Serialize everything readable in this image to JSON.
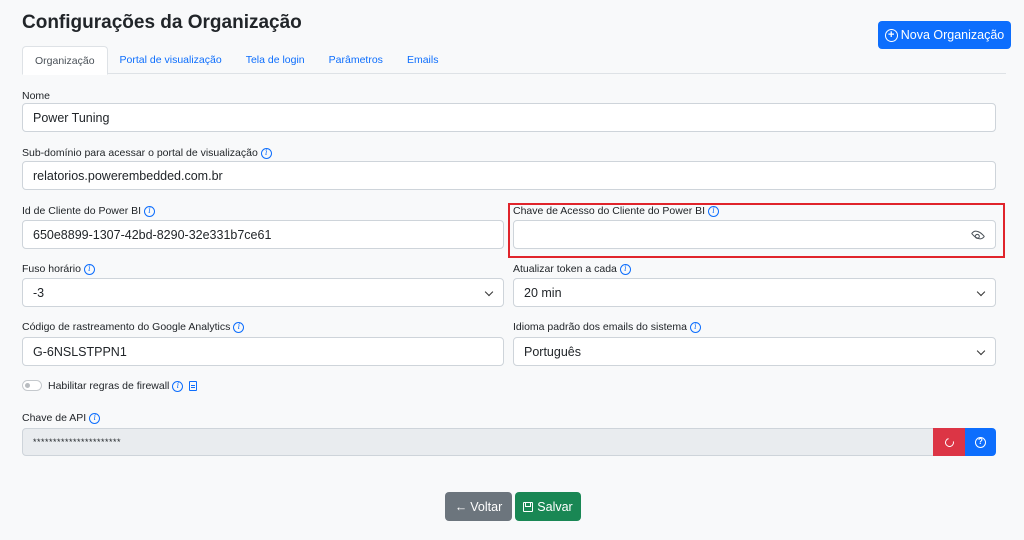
{
  "header": {
    "title": "Configurações da Organização",
    "new_org_label": "Nova Organização"
  },
  "tabs": [
    {
      "label": "Organização",
      "active": true
    },
    {
      "label": "Portal de visualização",
      "active": false
    },
    {
      "label": "Tela de login",
      "active": false
    },
    {
      "label": "Parâmetros",
      "active": false
    },
    {
      "label": "Emails",
      "active": false
    }
  ],
  "form": {
    "name": {
      "label": "Nome",
      "value": "Power Tuning"
    },
    "subdomain": {
      "label": "Sub-domínio para acessar o portal de visualização",
      "value": "relatorios.powerembedded.com.br"
    },
    "client_id": {
      "label": "Id de Cliente do Power BI",
      "value": "650e8899-1307-42bd-8290-32e331b7ce61"
    },
    "client_key": {
      "label": "Chave de Acesso do Cliente do Power BI",
      "value": ""
    },
    "timezone": {
      "label": "Fuso horário",
      "value": "-3"
    },
    "token_refresh": {
      "label": "Atualizar token a cada",
      "value": "20 min"
    },
    "analytics": {
      "label": "Código de rastreamento do Google Analytics",
      "value": "G-6NSLSTPPN1"
    },
    "email_language": {
      "label": "Idioma padrão dos emails do sistema",
      "value": "Português"
    },
    "firewall": {
      "label": "Habilitar regras de firewall",
      "enabled": false
    },
    "api_key": {
      "label": "Chave de API",
      "value": "**********************"
    }
  },
  "footer": {
    "back_label": "Voltar",
    "save_label": "Salvar"
  },
  "icons": {
    "info_glyph": "i",
    "help_glyph": "?",
    "back_arrow": "←",
    "plus_glyph": "+"
  },
  "colors": {
    "primary": "#0d6efd",
    "danger": "#dc3545",
    "success": "#198754",
    "secondary": "#6c757d",
    "highlight": "#e0242b"
  }
}
